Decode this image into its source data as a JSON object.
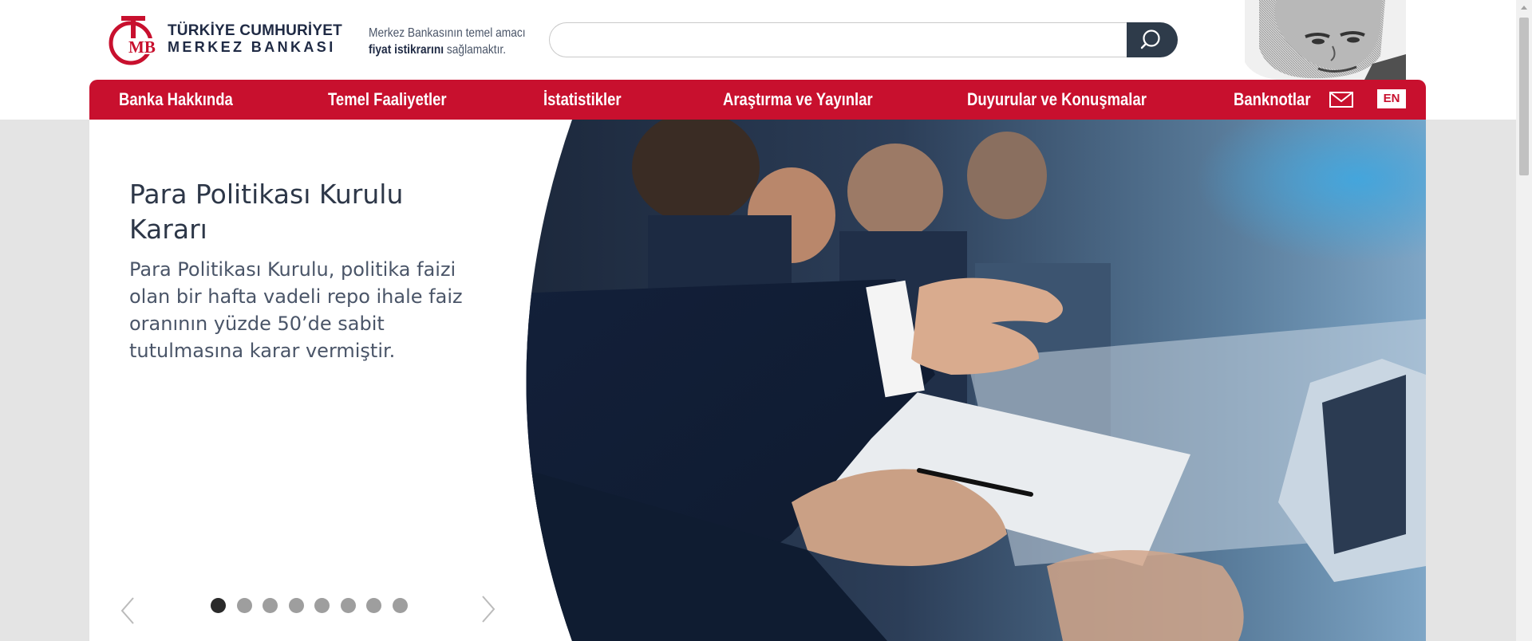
{
  "brand": {
    "logo_letters": "TCMB",
    "name_line1": "TÜRKİYE CUMHURİYET",
    "name_line2": "MERKEZ BANKASI"
  },
  "tagline": {
    "line1": "Merkez Bankasının temel amacı",
    "line2_bold": "fiyat istikrarını",
    "line2_rest": " sağlamaktır."
  },
  "search": {
    "placeholder": "",
    "value": "",
    "button_icon": "search-icon"
  },
  "nav": {
    "items": [
      {
        "label": "Banka Hakkında"
      },
      {
        "label": "Temel Faaliyetler"
      },
      {
        "label": "İstatistikler"
      },
      {
        "label": "Araştırma ve Yayınlar"
      },
      {
        "label": "Duyurular ve Konuşmalar"
      },
      {
        "label": "Banknotlar"
      }
    ],
    "mail_icon": "mail-icon",
    "lang_label": "EN"
  },
  "slider": {
    "title": "Para Politikası Kurulu Kararı",
    "text": "Para Politikası Kurulu, politika faizi olan bir hafta vadeli repo ihale faiz oranının yüzde 50’de sabit tutulmasına karar vermiştir.",
    "slide_count": 8,
    "active_slide": 1,
    "prev_icon": "chevron-left-icon",
    "next_icon": "chevron-right-icon"
  },
  "colors": {
    "brand_red": "#c8102e",
    "dark_navy": "#2e3b4a",
    "page_bg": "#e4e4e4"
  }
}
